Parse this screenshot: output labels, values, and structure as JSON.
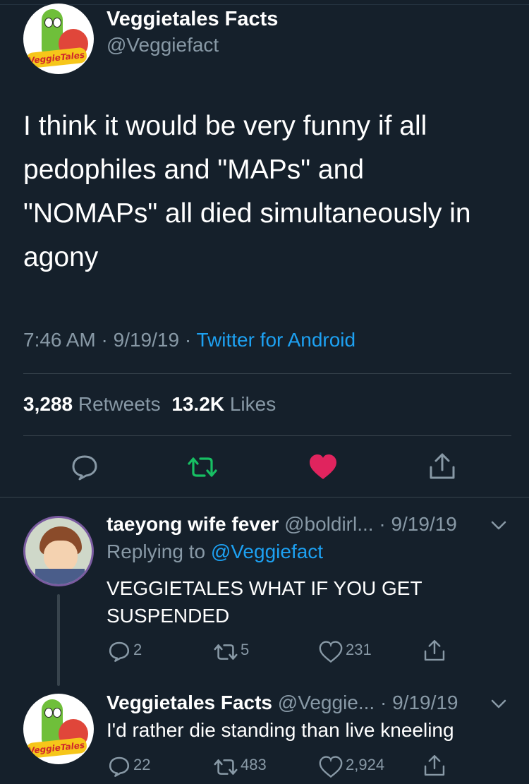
{
  "main_tweet": {
    "author_name": "Veggietales Facts",
    "author_handle": "@Veggiefact",
    "avatar_logo_text": "VeggieTales",
    "text": "I think it would be very funny if all pedophiles and \"MAPs\" and \"NOMAPs\" all died simultaneously in agony",
    "text_lines": [
      "I think it would be very funny if all",
      "pedophiles and \"MAPs\" and",
      "\"NOMAPs\" all died simultaneously in",
      "agony"
    ],
    "time": "7:46 AM",
    "date": "9/19/19",
    "separator": "·",
    "source": "Twitter for Android",
    "retweets_count": "3,288",
    "retweets_label": "Retweets",
    "likes_count": "13.2K",
    "likes_label": "Likes",
    "liked": true,
    "colors": {
      "like_active": "#e0245e",
      "retweet": "#17bf63",
      "link": "#1da1f2"
    }
  },
  "replies": [
    {
      "author_name": "taeyong wife fever",
      "author_handle": "@boldirl...",
      "date": "· 9/19/19",
      "replying_prefix": "Replying to",
      "replying_handle": "@Veggiefact",
      "text_lines": [
        "VEGGIETALES WHAT IF YOU GET",
        "SUSPENDED"
      ],
      "reply_count": "2",
      "retweet_count": "5",
      "like_count": "231"
    },
    {
      "author_name": "Veggietales Facts",
      "author_handle": "@Veggie...",
      "date": "· 9/19/19",
      "avatar_logo_text": "VeggieTales",
      "text_lines": [
        "I'd rather die standing than live kneeling"
      ],
      "reply_count": "22",
      "retweet_count": "483",
      "like_count": "2,924"
    }
  ],
  "icons": [
    "reply-icon",
    "retweet-icon",
    "heart-icon",
    "share-icon",
    "chevron-down-icon"
  ]
}
